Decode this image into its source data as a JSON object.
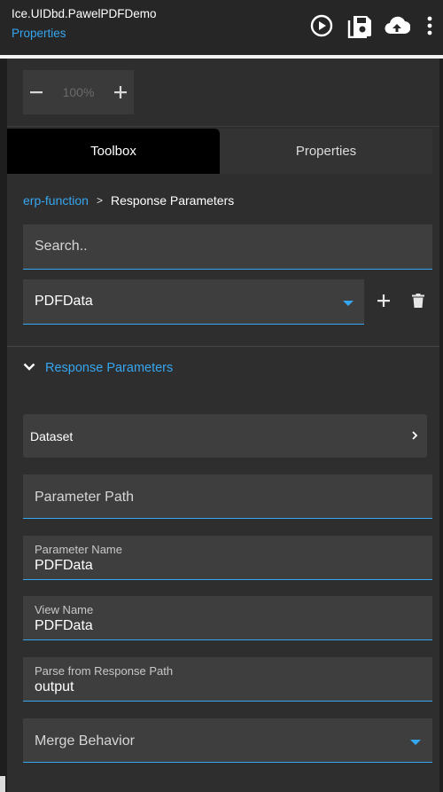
{
  "header": {
    "app_title": "Ice.UIDbd.PawelPDFDemo",
    "subtitle": "Properties",
    "icons": [
      "play-circle-icon",
      "save-icon",
      "cloud-upload-icon",
      "more-vert-icon"
    ]
  },
  "zoom": {
    "minus": "−",
    "value": "100%",
    "plus": "+"
  },
  "tabs": [
    {
      "label": "Toolbox",
      "active": true
    },
    {
      "label": "Properties",
      "active": false
    }
  ],
  "breadcrumb": {
    "parent": "erp-function",
    "separator": ">",
    "current": "Response Parameters"
  },
  "search": {
    "placeholder": "Search..",
    "value": ""
  },
  "selector": {
    "value": "PDFData",
    "add_icon": "plus-icon",
    "delete_icon": "trash-icon"
  },
  "section": {
    "title": "Response Parameters",
    "expanded": true
  },
  "dataset": {
    "label": "Dataset"
  },
  "fields": {
    "parameter_path": {
      "placeholder": "Parameter Path",
      "value": ""
    },
    "parameter_name": {
      "label": "Parameter Name",
      "value": "PDFData"
    },
    "view_name": {
      "label": "View Name",
      "value": "PDFData"
    },
    "parse_path": {
      "label": "Parse from Response Path",
      "value": "output"
    },
    "merge_behavior": {
      "placeholder": "Merge Behavior",
      "value": ""
    }
  },
  "colors": {
    "accent": "#35a6f0",
    "background": "#2e2e2e",
    "field_bg": "#3e3e3e",
    "header_bg": "#262626",
    "active_tab": "#000000"
  }
}
